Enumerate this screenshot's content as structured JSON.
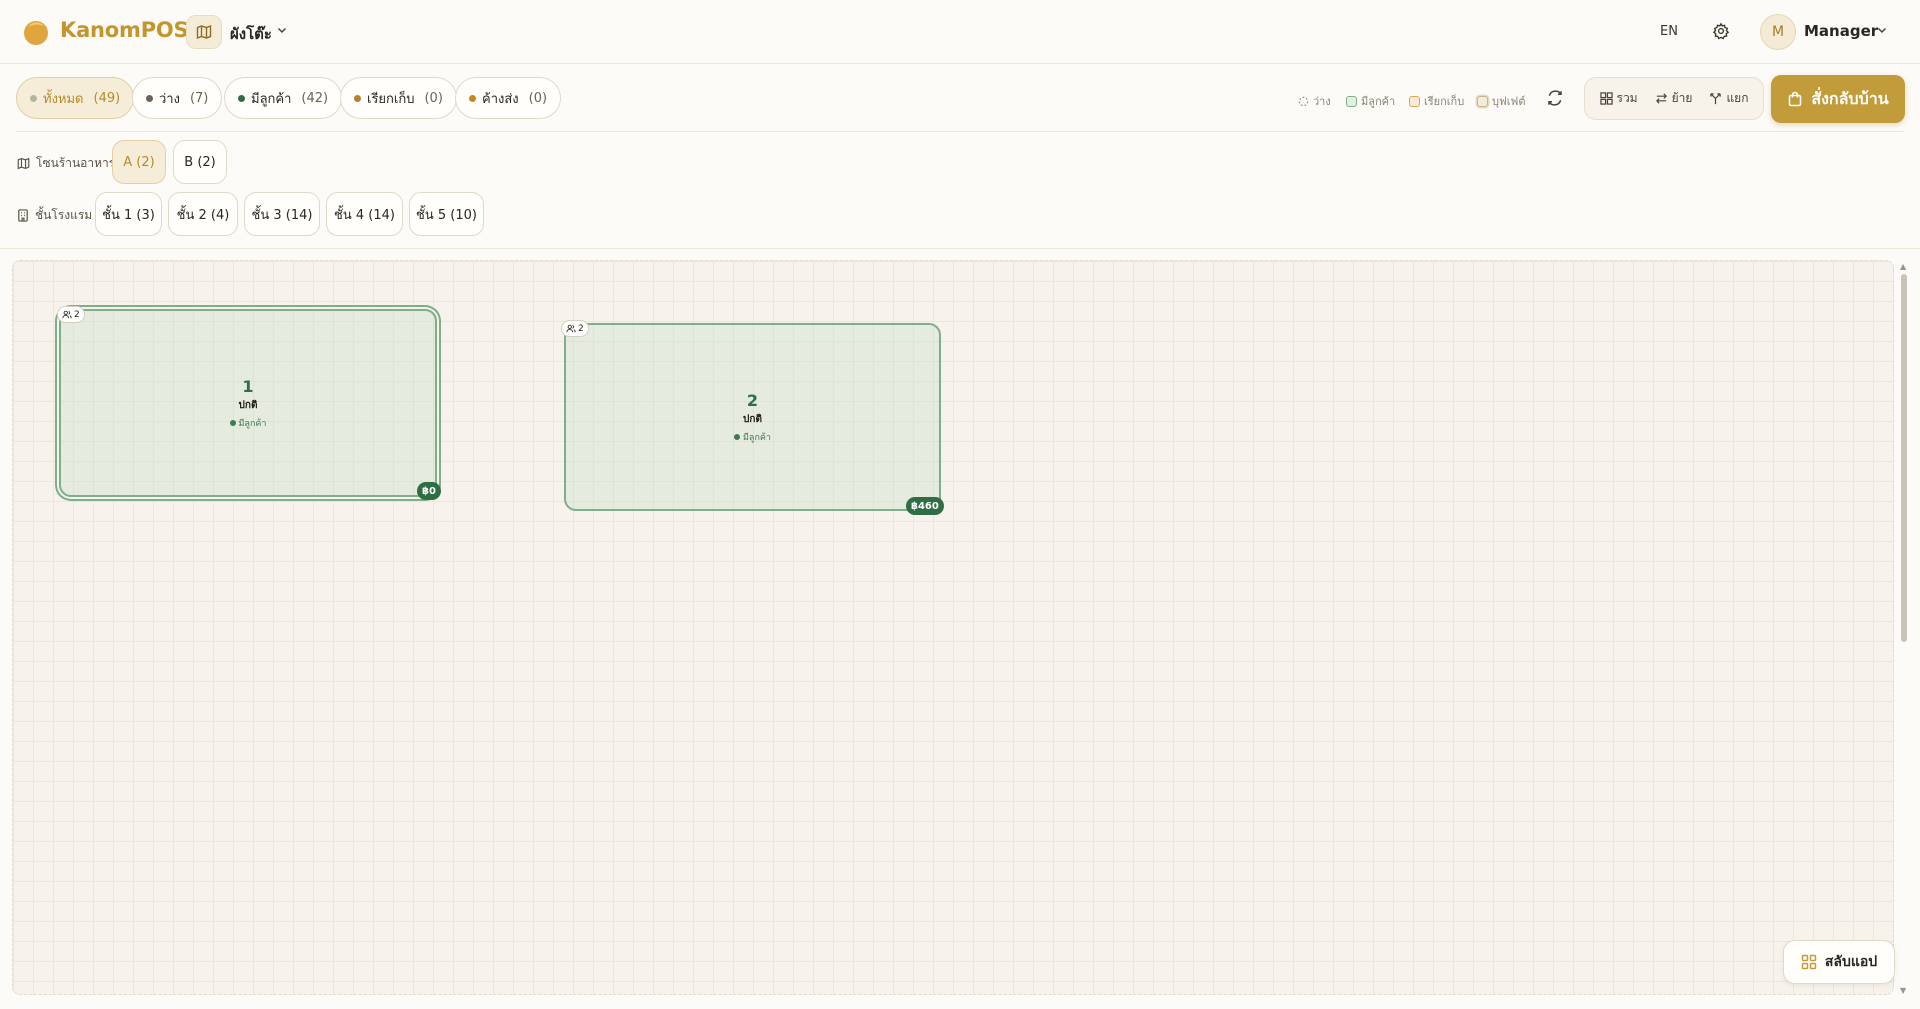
{
  "header": {
    "brand": "KanomPOS",
    "view_label": "ผังโต๊ะ",
    "lang": "EN",
    "user_initial": "M",
    "user_name": "Manager",
    "icons": [
      "logo-icon",
      "map-icon",
      "chevron-down-icon",
      "gear-icon"
    ]
  },
  "status_filters": [
    {
      "label": "ทั้งหมด",
      "count": "(49)",
      "dot": "#b9b2a3",
      "active": true
    },
    {
      "label": "ว่าง",
      "count": "(7)",
      "dot": "#6b6456"
    },
    {
      "label": "มีลูกค้า",
      "count": "(42)",
      "dot": "#2f6d44"
    },
    {
      "label": "เรียกเก็บ",
      "count": "(0)",
      "dot": "#b8802a"
    },
    {
      "label": "ค้างส่ง",
      "count": "(0)",
      "dot": "#c28a1e"
    }
  ],
  "legend": {
    "empty": "ว่าง",
    "occupied": "มีลูกค้า",
    "billing": "เรียกเก็บ",
    "buffet": "บุฟเฟต์"
  },
  "actions": {
    "merge": "รวม",
    "move": "ย้าย",
    "split": "แยก",
    "takeaway": "สั่งกลับบ้าน"
  },
  "zones": {
    "label": "โซนร้านอาหาร",
    "items": [
      "A (2)",
      "B (2)"
    ],
    "active": "A (2)"
  },
  "floors": {
    "label": "ชั้นโรงแรม",
    "items": [
      "ชั้น 1 (3)",
      "ชั้น 2 (4)",
      "ชั้น 3 (14)",
      "ชั้น 4 (14)",
      "ชั้น 5 (10)"
    ]
  },
  "tables": [
    {
      "number": "1",
      "status": "ปกติ",
      "occupancy": "มีลูกค้า",
      "seats": "2",
      "total": "฿0",
      "selected": true
    },
    {
      "number": "2",
      "status": "ปกติ",
      "occupancy": "มีลูกค้า",
      "seats": "2",
      "total": "฿460"
    }
  ],
  "switch_app": "สลับแอป",
  "colors": {
    "brand": "#c4952f",
    "primary": "#c29b3a",
    "occupied": "#2f6d44",
    "table_border": "#7fae8a"
  }
}
